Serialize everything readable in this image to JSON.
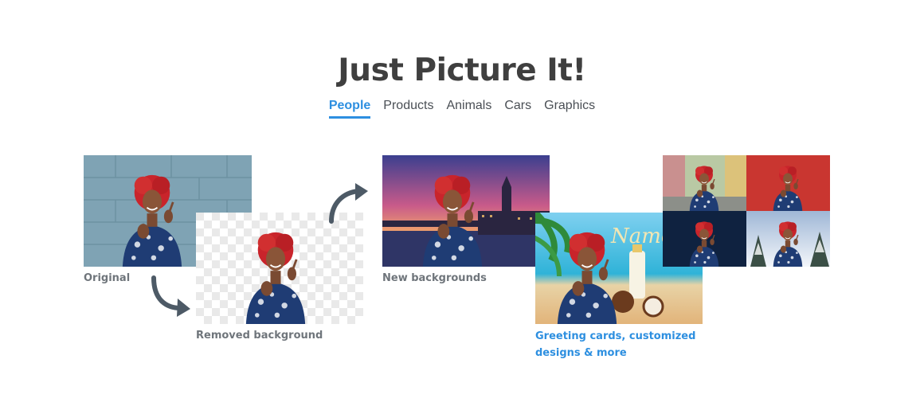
{
  "heading": "Just Picture It!",
  "tabs": [
    "People",
    "Products",
    "Animals",
    "Cars",
    "Graphics"
  ],
  "active_tab": "People",
  "captions": {
    "original": "Original",
    "removed": "Removed background",
    "new_backgrounds": "New backgrounds",
    "greeting_line1": "Greeting cards, customized",
    "greeting_line2": "designs & more"
  },
  "card_script_text": "Name",
  "colors": {
    "accent": "#2d8fe0",
    "heading": "#3f3f3f",
    "caption": "#6f757b",
    "arrow": "#4d5a66",
    "wall": "#7fa3b4",
    "hair": "#c9242b",
    "blouse": "#1f3c74"
  }
}
